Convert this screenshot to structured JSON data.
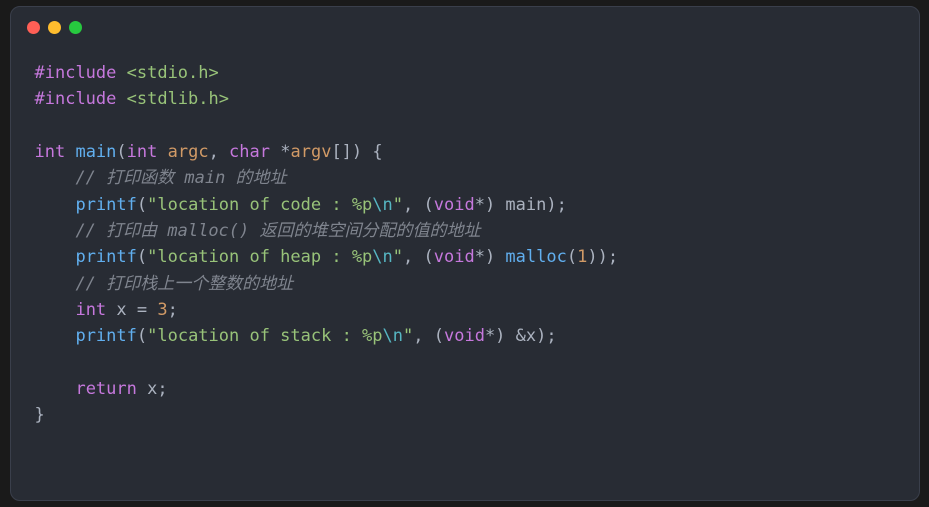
{
  "titlebar": {
    "red": "red",
    "yellow": "yellow",
    "green": "green"
  },
  "code": {
    "line1_include": "#include ",
    "line1_header": "<stdio.h>",
    "line2_include": "#include ",
    "line2_header": "<stdlib.h>",
    "line4_int": "int",
    "line4_main": " main",
    "line4_open": "(",
    "line4_int2": "int",
    "line4_argc": " argc",
    "line4_comma": ", ",
    "line4_char": "char",
    "line4_star": " *",
    "line4_argv": "argv",
    "line4_brackets": "[]",
    "line4_close": ") {",
    "line5_comment": "    // 打印函数 main 的地址",
    "line6_indent": "    ",
    "line6_printf": "printf",
    "line6_open": "(",
    "line6_str1": "\"location of code : %p",
    "line6_escape": "\\n",
    "line6_str2": "\"",
    "line6_comma": ", (",
    "line6_void": "void",
    "line6_star": "*) main);",
    "line7_comment": "    // 打印由 malloc() 返回的堆空间分配的值的地址",
    "line8_indent": "    ",
    "line8_printf": "printf",
    "line8_open": "(",
    "line8_str1": "\"location of heap : %p",
    "line8_escape": "\\n",
    "line8_str2": "\"",
    "line8_comma": ", (",
    "line8_void": "void",
    "line8_star": "*) ",
    "line8_malloc": "malloc",
    "line8_args": "(",
    "line8_one": "1",
    "line8_end": "));",
    "line9_comment": "    // 打印栈上一个整数的地址",
    "line10_indent": "    ",
    "line10_int": "int",
    "line10_x": " x = ",
    "line10_three": "3",
    "line10_semi": ";",
    "line11_indent": "    ",
    "line11_printf": "printf",
    "line11_open": "(",
    "line11_str1": "\"location of stack : %p",
    "line11_escape": "\\n",
    "line11_str2": "\"",
    "line11_comma": ", (",
    "line11_void": "void",
    "line11_star": "*) &x);",
    "line13_indent": "    ",
    "line13_return": "return",
    "line13_x": " x;",
    "line14_brace": "}"
  }
}
